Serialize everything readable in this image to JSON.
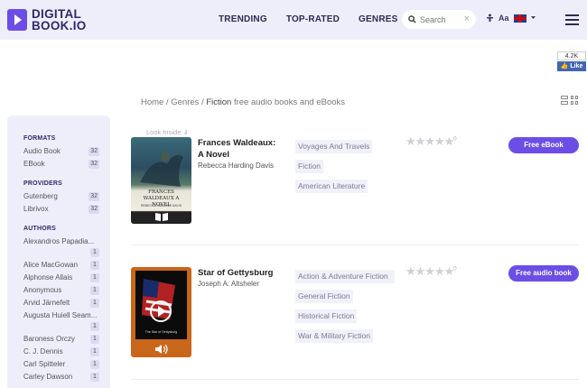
{
  "header": {
    "logo_line1": "DIGITAL",
    "logo_line2": "BOOK.IO",
    "nav": [
      "TRENDING",
      "TOP-RATED",
      "GENRES"
    ],
    "search_placeholder": "Search",
    "font_label": "Aa"
  },
  "fb": {
    "count": "4.2K",
    "like": "Like"
  },
  "breadcrumb": {
    "home": "Home",
    "sep": "/",
    "genres": "Genres",
    "current": "Fiction",
    "suffix": "free audio books and eBooks"
  },
  "sidebar": {
    "formats_heading": "FORMATS",
    "formats": [
      {
        "label": "Audio Book",
        "count": "32"
      },
      {
        "label": "EBook",
        "count": "32"
      }
    ],
    "providers_heading": "PROVIDERS",
    "providers": [
      {
        "label": "Gutenberg",
        "count": "32"
      },
      {
        "label": "Librivox",
        "count": "32"
      }
    ],
    "authors_heading": "AUTHORS",
    "authors": [
      {
        "label": "Alexandros Papadia...",
        "count": "1"
      },
      {
        "label": "Alice MacGowan",
        "count": "1"
      },
      {
        "label": "Alphonse Allais",
        "count": "1"
      },
      {
        "label": "Anonymous",
        "count": "1"
      },
      {
        "label": "Arvid Järnefelt",
        "count": "1"
      },
      {
        "label": "Augusta Huiell Seam...",
        "count": "1"
      },
      {
        "label": "Baroness Orczy",
        "count": "1"
      },
      {
        "label": "C. J. Dennis",
        "count": "1"
      },
      {
        "label": "Carl Spitteler",
        "count": "1"
      },
      {
        "label": "Carley Dawson",
        "count": "1"
      }
    ]
  },
  "books": [
    {
      "look_inside": "Look Inside",
      "title": "Frances Waldeaux: A Novel",
      "author": "Rebecca Harding Davis",
      "cover_title": "FRANCES WALDEAUX A NOVEL",
      "cover_author": "REBECCA HARDING DAVIS",
      "tags": [
        "Voyages And Travels",
        "Fiction",
        "American Literature"
      ],
      "rating_count": "0",
      "cta": "Free eBook"
    },
    {
      "title": "Star of Gettysburg",
      "author": "Joseph A. Altsheler",
      "cover_title": "The Star of Gettysburg",
      "tags": [
        "Action & Adventure Fiction",
        "General Fiction",
        "Historical Fiction",
        "War & Military Fiction"
      ],
      "rating_count": "0",
      "cta": "Free audio book"
    }
  ],
  "colors": {
    "accent": "#6c4ee6",
    "header_bg": "#eeeefb",
    "sidebar_bg": "#eeeefb"
  }
}
